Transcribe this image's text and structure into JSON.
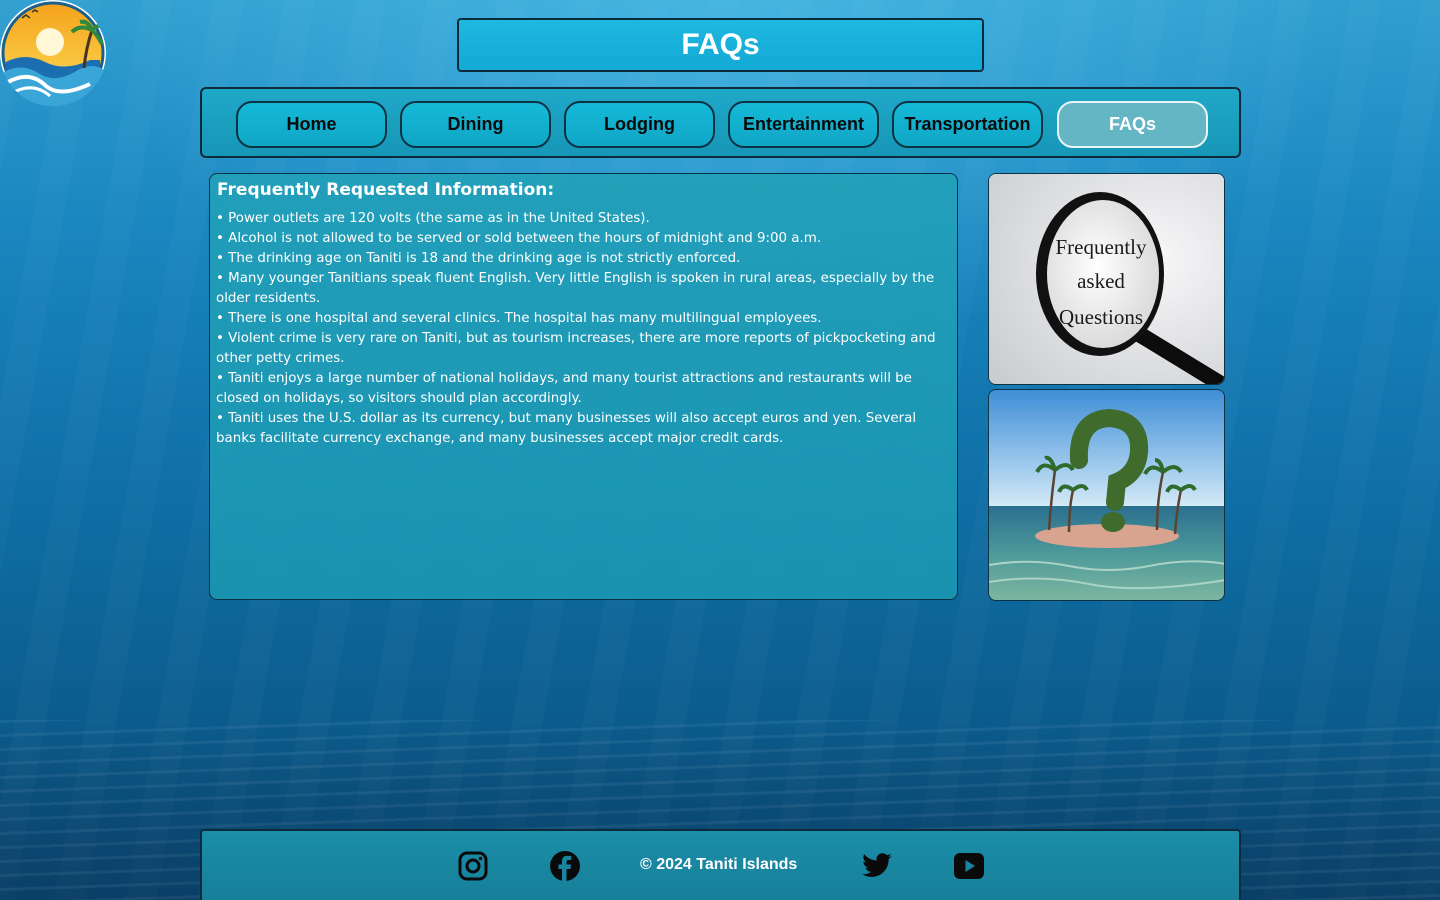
{
  "page_title": "FAQs",
  "logo": {
    "icon": "tropical-beach-sunset-logo"
  },
  "nav": {
    "items": [
      {
        "label": "Home"
      },
      {
        "label": "Dining"
      },
      {
        "label": "Lodging"
      },
      {
        "label": "Entertainment"
      },
      {
        "label": "Transportation"
      },
      {
        "label": "FAQs",
        "active": true
      }
    ]
  },
  "faq": {
    "heading": "Frequently Requested Information:",
    "items": [
      "• Power outlets are 120 volts (the same as in the United States).",
      "• Alcohol is not allowed to be served or sold between the hours of midnight and 9:00 a.m.",
      "• The drinking age on Taniti is 18 and the drinking age is not strictly enforced.",
      "• Many younger Tanitians speak fluent English. Very little English is spoken in rural areas, especially by the older residents.",
      "• There is one hospital and several clinics. The hospital has many multilingual employees.",
      "• Violent crime is very rare on Taniti, but as tourism increases, there are more reports of pickpocketing and other petty crimes.",
      "• Taniti enjoys a large number of national holidays, and many tourist attractions and restaurants will be closed on holidays, so visitors should plan accordingly.",
      "• Taniti uses the U.S. dollar as its currency, but many businesses will also accept euros and yen. Several banks facilitate currency exchange, and many businesses accept major credit cards."
    ]
  },
  "images": {
    "magnifier_text": [
      "Frequently",
      "asked",
      "Questions"
    ]
  },
  "footer": {
    "copyright": "© 2024 Taniti Islands",
    "social": [
      "instagram-icon",
      "facebook-icon",
      "twitter-icon",
      "youtube-icon"
    ]
  },
  "colors": {
    "panel": "#1fa0bb",
    "nav_button": "#12b0d0",
    "nav_button_active": "#64b6c4",
    "border": "#0b2a3a"
  }
}
